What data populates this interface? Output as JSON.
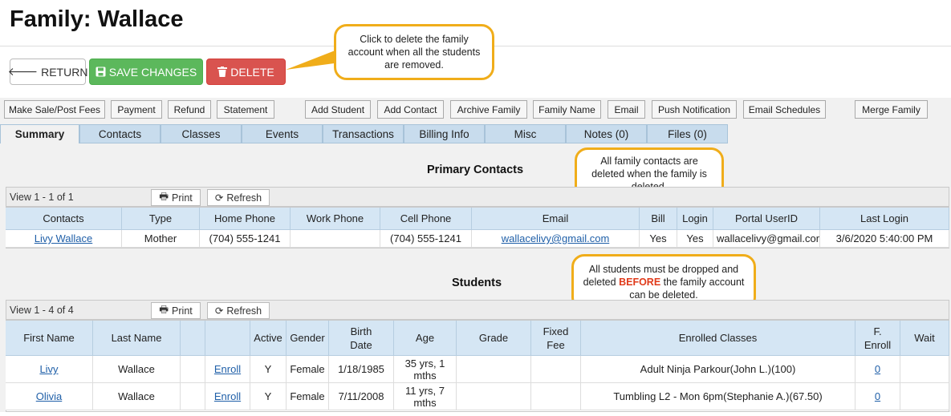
{
  "page_title": "Family: Wallace",
  "top_buttons": {
    "return": "RETURN",
    "save": "SAVE CHANGES",
    "delete": "DELETE"
  },
  "callouts": {
    "delete": "Click to delete the family account when all the students are removed.",
    "contacts": "All family contacts are deleted when the family is deleted.",
    "students_pre": "All students must be dropped and deleted",
    "students_em": "BEFORE",
    "students_post": "the family account can be deleted."
  },
  "action_buttons": [
    "Make Sale/Post Fees",
    "Payment",
    "Refund",
    "Statement",
    "Add Student",
    "Add Contact",
    "Archive Family",
    "Family Name",
    "Email",
    "Push Notification",
    "Email Schedules",
    "Merge Family"
  ],
  "tabs": [
    "Summary",
    "Contacts",
    "Classes",
    "Events",
    "Transactions",
    "Billing Info",
    "Misc",
    "Notes (0)",
    "Files (0)"
  ],
  "contacts_section": {
    "title": "Primary Contacts",
    "view": "View 1 - 1 of 1",
    "print": "Print",
    "refresh": "Refresh",
    "columns": [
      "Contacts",
      "Type",
      "Home Phone",
      "Work Phone",
      "Cell Phone",
      "Email",
      "Bill",
      "Login",
      "Portal UserID",
      "Last Login"
    ],
    "rows": [
      [
        "Livy Wallace",
        "Mother",
        "(704) 555-1241",
        "",
        "(704) 555-1241",
        "wallacelivy@gmail.com",
        "Yes",
        "Yes",
        "wallacelivy@gmail.com",
        "3/6/2020 5:40:00 PM"
      ]
    ]
  },
  "students_section": {
    "title": "Students",
    "view": "View 1 - 4 of 4",
    "print": "Print",
    "refresh": "Refresh",
    "columns": [
      "First Name",
      "Last Name",
      "",
      "",
      "Active",
      "Gender",
      "Birth Date",
      "Age",
      "Grade",
      "Fixed Fee",
      "Enrolled Classes",
      "F. Enroll",
      "Wait"
    ],
    "rows": [
      [
        "Livy",
        "Wallace",
        "",
        "Enroll",
        "Y",
        "Female",
        "1/18/1985",
        "35 yrs, 1 mths",
        "",
        "",
        "Adult Ninja Parkour(John L.)(100)",
        "0",
        ""
      ],
      [
        "Olivia",
        "Wallace",
        "",
        "Enroll",
        "Y",
        "Female",
        "7/11/2008",
        "11 yrs, 7 mths",
        "",
        "",
        "Tumbling L2 - Mon 6pm(Stephanie A.)(67.50)",
        "0",
        ""
      ]
    ]
  },
  "colors": {
    "save": "#5cb85c",
    "delete": "#d9534f",
    "callout_border": "#f0ad1a",
    "tab": "#c8dced",
    "header": "#d5e6f4"
  }
}
